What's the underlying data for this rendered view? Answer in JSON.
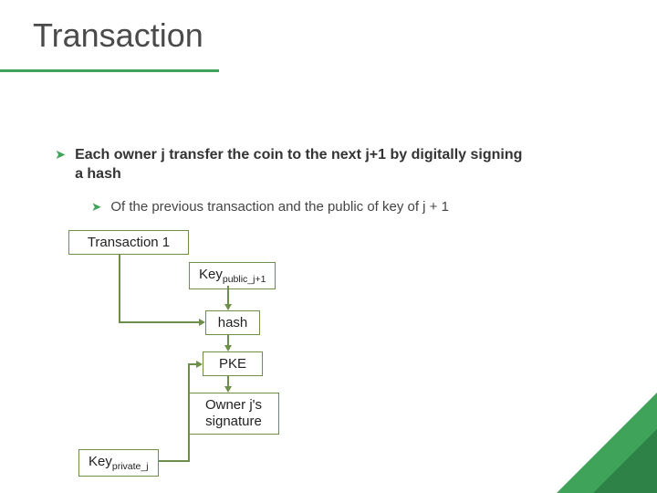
{
  "title": "Transaction",
  "bullets": {
    "main": "Each owner j transfer the coin to the next j+1 by digitally signing a hash",
    "sub": "Of the previous transaction and the public of key of j + 1"
  },
  "boxes": {
    "transaction1": "Transaction 1",
    "key_public_label": "Key",
    "key_public_sub": "public_j+1",
    "hash": "hash",
    "pke": "PKE",
    "signature_line1": "Owner j's",
    "signature_line2": "signature",
    "key_private_label": "Key",
    "key_private_sub": "private_j"
  }
}
